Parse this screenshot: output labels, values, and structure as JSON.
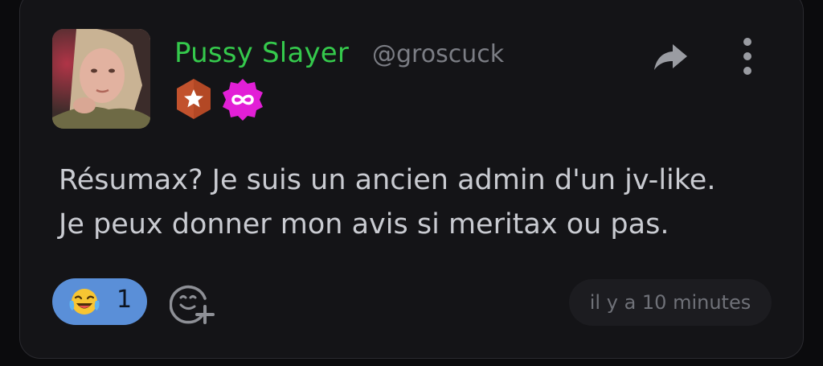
{
  "post": {
    "author": {
      "display_name": "Pussy Slayer",
      "handle": "@groscuck",
      "name_color": "#35c94c",
      "badges": [
        {
          "icon": "star-icon",
          "color": "#c2522d"
        },
        {
          "icon": "infinity-icon",
          "color": "#e21fd6"
        }
      ]
    },
    "message_lines": [
      "Résumax? Je suis un ancien admin d'un jv-like.",
      "Je peux donner mon avis si meritax ou pas."
    ],
    "reactions": [
      {
        "emoji": "face-with-tears-of-joy-icon",
        "count": "1",
        "color": "#5a8fd8"
      }
    ],
    "timestamp": "il y a 10 minutes",
    "actions": {
      "share_icon": "share-arrow-icon",
      "more_icon": "more-vertical-icon",
      "add_reaction_icon": "add-reaction-icon"
    }
  }
}
